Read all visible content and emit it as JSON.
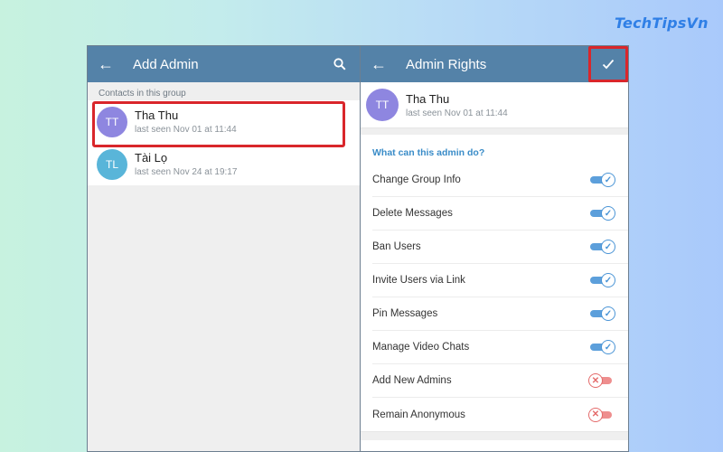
{
  "brand": "TechTipsVn",
  "left": {
    "title": "Add Admin",
    "back_icon": "arrow-left-icon",
    "search_icon": "search-icon",
    "section_label": "Contacts in this group",
    "contacts": [
      {
        "initials": "TT",
        "name": "Tha Thu",
        "status": "last seen Nov 01 at 11:44",
        "color": "#8e86e0",
        "highlighted": true
      },
      {
        "initials": "TL",
        "name": "Tài Lọ",
        "status": "last seen Nov 24 at 19:17",
        "color": "#59b5d9",
        "highlighted": false
      }
    ]
  },
  "right": {
    "title": "Admin Rights",
    "back_icon": "arrow-left-icon",
    "confirm_icon": "checkmark-icon",
    "user": {
      "initials": "TT",
      "name": "Tha Thu",
      "status": "last seen Nov 01 at 11:44",
      "color": "#8e86e0"
    },
    "question": "What can this admin do?",
    "permissions": [
      {
        "label": "Change Group Info",
        "enabled": true
      },
      {
        "label": "Delete Messages",
        "enabled": true
      },
      {
        "label": "Ban Users",
        "enabled": true
      },
      {
        "label": "Invite Users via Link",
        "enabled": true
      },
      {
        "label": "Pin Messages",
        "enabled": true
      },
      {
        "label": "Manage Video Chats",
        "enabled": true
      },
      {
        "label": "Add New Admins",
        "enabled": false
      },
      {
        "label": "Remain Anonymous",
        "enabled": false
      }
    ]
  },
  "colors": {
    "appbar": "#5482a8",
    "accent": "#3a8cc8",
    "highlight": "#d9262b",
    "toggle_on": "#5c9fdb",
    "toggle_off": "#ee8e8e"
  }
}
